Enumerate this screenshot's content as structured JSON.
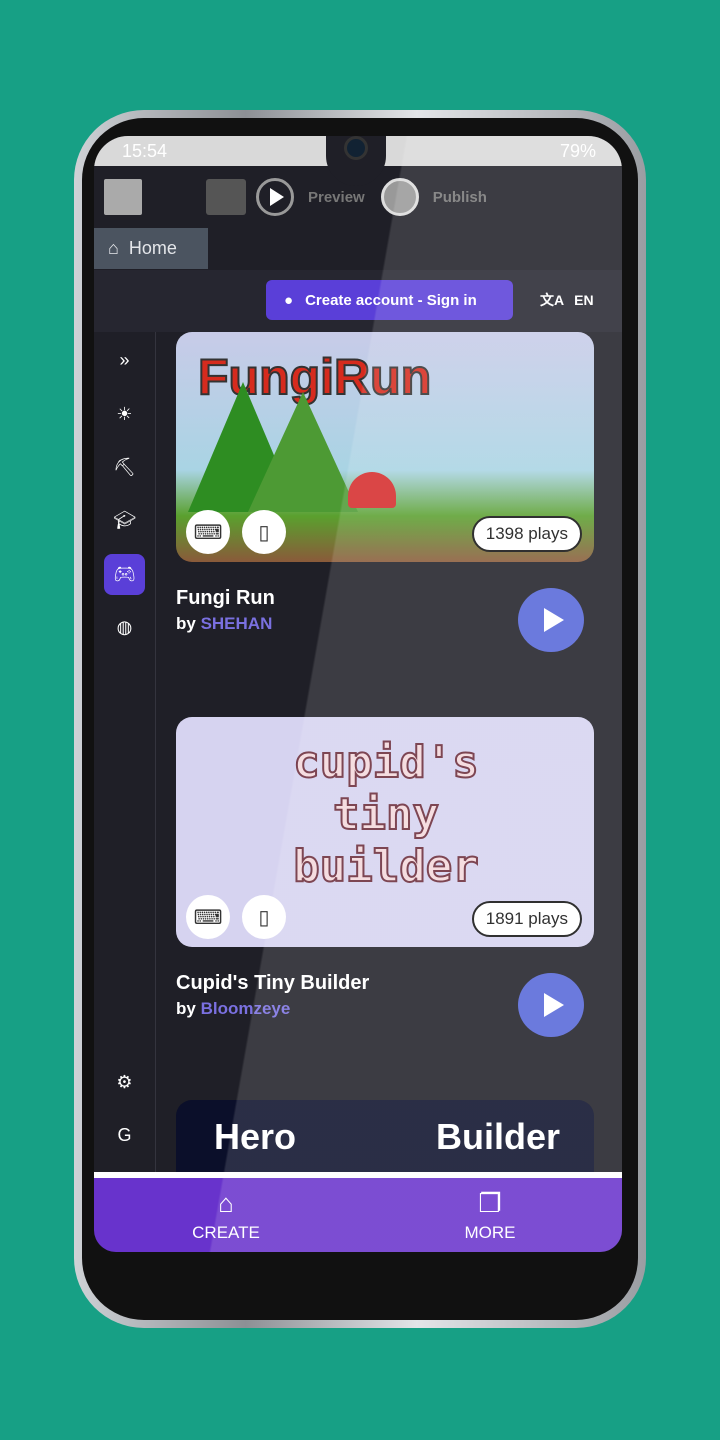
{
  "status": {
    "time": "15:54",
    "battery": "79%"
  },
  "toolbar": {
    "preview": "Preview",
    "publish": "Publish"
  },
  "tabs": {
    "home": "Home"
  },
  "account": {
    "button": "Create account - Sign in",
    "lang": "EN"
  },
  "sidebar": {
    "icons": [
      "chevrons-right-icon",
      "sun-icon",
      "pickaxe-icon",
      "graduation-cap-icon",
      "gamepad-icon",
      "globe-icon",
      "gear-icon",
      "gdevelop-logo-icon"
    ],
    "active": "gamepad-icon"
  },
  "games": [
    {
      "title": "Fungi Run",
      "by": "by ",
      "author": "SHEHAN",
      "plays": "1398 plays",
      "thumb_text": "FungiRun"
    },
    {
      "title": "Cupid's Tiny Builder",
      "by": "by ",
      "author": "Bloomzeye",
      "plays": "1891 plays",
      "thumb_text": "cupid's tiny builder"
    },
    {
      "thumb_text": "Hero Builder"
    }
  ],
  "bottom_nav": {
    "create": "CREATE",
    "more": "MORE"
  },
  "colors": {
    "accent": "#5a3fd8",
    "nav": "#6833cc",
    "play": "#5566d8",
    "background": "#17a085"
  }
}
